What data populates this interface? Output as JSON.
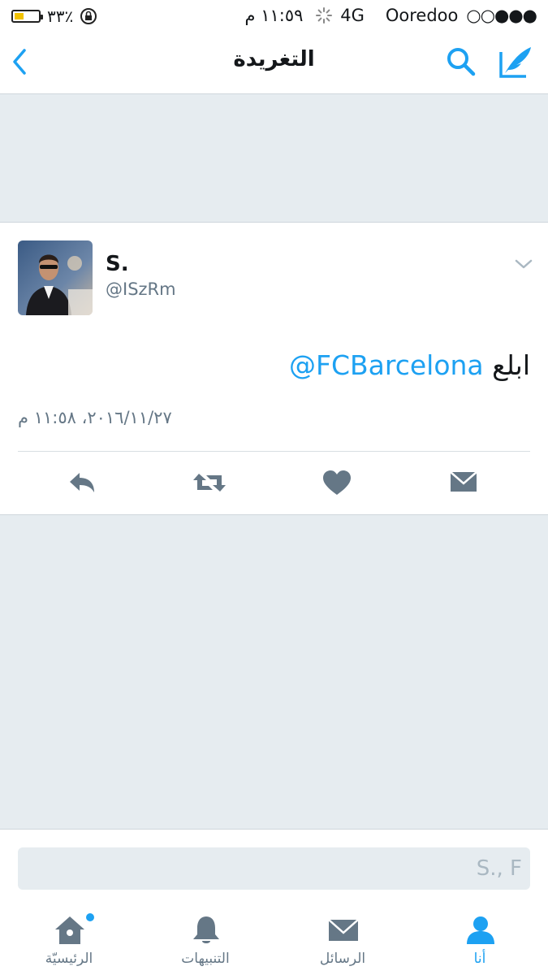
{
  "status_bar": {
    "battery_percent_text": "٣٣٪",
    "battery_level": 0.33,
    "time": "١١:٥٩ م",
    "network": "4G",
    "carrier": "Ooredoo",
    "signal_dots": "○○●●●"
  },
  "header": {
    "title": "التغريدة",
    "back_icon": "chevron-left-icon",
    "search_icon": "search-icon",
    "compose_icon": "compose-tweet-icon"
  },
  "tweet": {
    "avatar_icon": "user-photo",
    "display_name": "S.",
    "handle": "@ISzRm",
    "text_word": "ابلع",
    "mention": "@FCBarcelona",
    "timestamp": "٢٠١٦/١١/٢٧، ١١:٥٨ م",
    "actions": [
      "reply-icon",
      "retweet-icon",
      "like-icon",
      "direct-message-icon"
    ]
  },
  "reply": {
    "placeholder": "S., F"
  },
  "tabs": [
    {
      "label": "الرئيسيّة",
      "icon": "home-icon",
      "has_badge": true
    },
    {
      "label": "التنبيهات",
      "icon": "bell-icon"
    },
    {
      "label": "الرسائل",
      "icon": "envelope-icon"
    },
    {
      "label": "أنا",
      "icon": "profile-icon",
      "active": true
    }
  ],
  "colors": {
    "accent": "#1da1f2",
    "icon_gray": "#657786",
    "background": "#e6ecf0"
  }
}
